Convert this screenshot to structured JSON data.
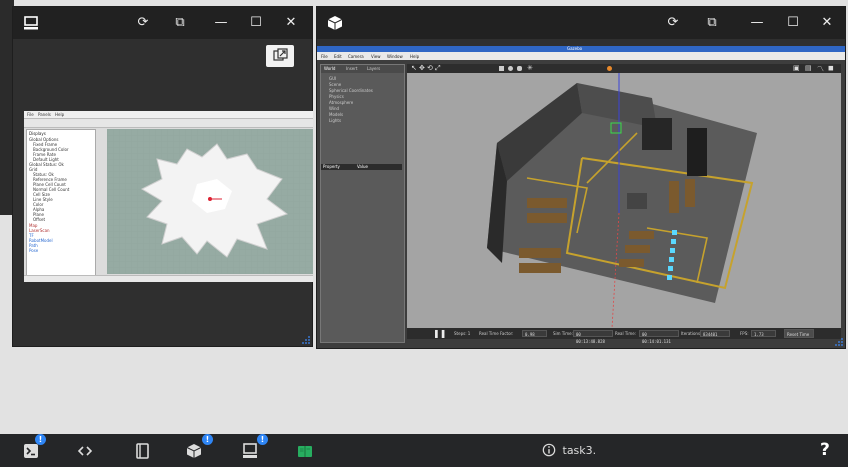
{
  "left_window": {
    "float_button_icon": "external-window-icon",
    "rviz": {
      "menu": [
        "File",
        "Panels",
        "Help"
      ],
      "displays_title": "Displays",
      "tree_rows": [
        "Global Options",
        "Fixed Frame",
        "Background Color",
        "Frame Rate",
        "Default Light",
        "Global Status: Ok",
        "Grid",
        "Status: Ok",
        "Reference Frame",
        "Plane Cell Count",
        "Normal Cell Count",
        "Cell Size",
        "Line Style",
        "Color",
        "Alpha",
        "Plane",
        "Offset",
        "Map",
        "LaserScan",
        "TF",
        "RobotModel",
        "Path",
        "Pose"
      ]
    }
  },
  "right_window": {
    "gazebo": {
      "app_title": "Gazebo",
      "menu": [
        "File",
        "Edit",
        "Camera",
        "View",
        "Window",
        "Help"
      ],
      "tabs": [
        "World",
        "Insert",
        "Layers"
      ],
      "tree": [
        "GUI",
        "Scene",
        "Spherical Coordinates",
        "Physics",
        "Atmosphere",
        "Wind",
        "Models",
        "Lights"
      ],
      "property_header": "Property",
      "value_header": "Value",
      "status": {
        "steps": "Steps: 1",
        "rtf_label": "Real Time Factor:",
        "rtf": "0.98",
        "sim_time_label": "Sim Time:",
        "sim_time": "00 00:13:48.828",
        "real_time_label": "Real Time:",
        "real_time": "00 00:14:01.131",
        "iterations_label": "Iterations:",
        "iterations": "834401",
        "fps_label": "FPS:",
        "fps": "1.73",
        "reset_label": "Reset Time"
      }
    }
  },
  "taskbar": {
    "center_label": "task3.",
    "help_label": "?",
    "badge_text": "!"
  },
  "colors": {
    "taskbar": "#252628",
    "badge": "#2f86f6",
    "book_icon": "#27ae60"
  }
}
